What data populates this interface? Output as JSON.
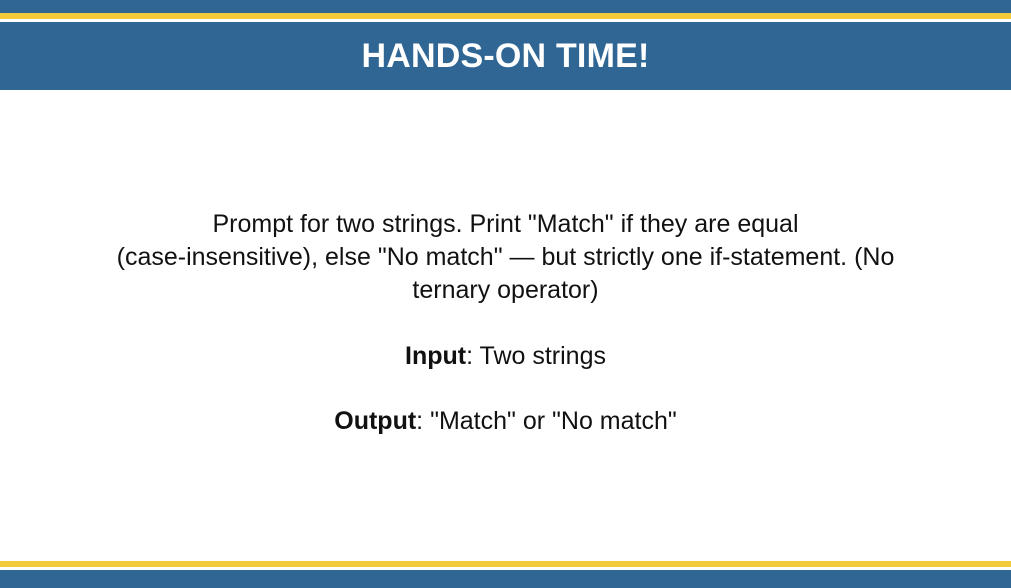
{
  "header": {
    "title": "HANDS-ON TIME!"
  },
  "task": {
    "prompt_line1": "Prompt for two strings. Print \"Match\" if they are equal",
    "prompt_line2": "(case-insensitive), else \"No match\" — but strictly one if-statement. (No",
    "prompt_line3": "ternary operator)",
    "input_label": "Input",
    "input_text": ": Two strings",
    "output_label": "Output",
    "output_text": ": \"Match\" or \"No match\""
  },
  "colors": {
    "header_blue": "#2f6693",
    "accent_yellow": "#f3cb3a",
    "text": "#111111",
    "background": "#ffffff"
  }
}
